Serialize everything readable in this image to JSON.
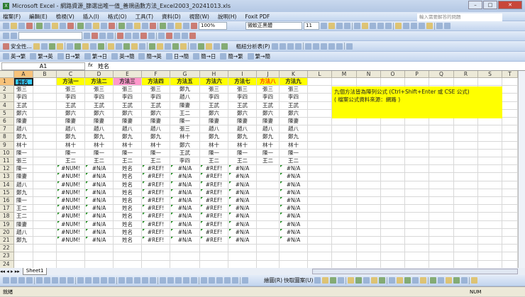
{
  "window": {
    "title": "Microsoft Excel - 網路資源_篩選出唯一值_善規函數方法_Excel2003_20241013.xls"
  },
  "menu": [
    "檔案(F)",
    "編輯(E)",
    "檢視(V)",
    "插入(I)",
    "格式(O)",
    "工具(T)",
    "資料(D)",
    "視窗(W)",
    "說明(H)",
    "Foxit PDF"
  ],
  "help_placeholder": "輸入需要解答的問題",
  "toolbar": {
    "zoom": "100%",
    "font": "微軟正黑體",
    "size": "11",
    "security": "安全性...",
    "pivot": "樞紐分析表(P)",
    "convert": [
      "英→繁",
      "繁→英",
      "日→繁",
      "繁→日",
      "英→簡",
      "簡→英",
      "日→簡",
      "簡→日",
      "簡→繁",
      "繁→簡"
    ],
    "draw": "繪圖(R)",
    "autoshape": "快取圖案(U)"
  },
  "formula_bar": {
    "name_box": "A1",
    "fx": "fx",
    "value": "姓名"
  },
  "columns": [
    "A",
    "B",
    "C",
    "D",
    "E",
    "F",
    "G",
    "H",
    "I",
    "J",
    "K",
    "L",
    "M",
    "N",
    "O",
    "P",
    "Q",
    "R",
    "S",
    "T"
  ],
  "rows": [
    [
      "姓名",
      "",
      "方法一",
      "方法二",
      "方法三",
      "方法四",
      "方法五",
      "方法六",
      "方法七",
      "方法八",
      "方法九"
    ],
    [
      "張三",
      "",
      "張三",
      "張三",
      "張三",
      "張三",
      "鄭九",
      "張三",
      "張三",
      "張三",
      "張三"
    ],
    [
      "李四",
      "",
      "李四",
      "李四",
      "李四",
      "李四",
      "趙八",
      "李四",
      "李四",
      "李四",
      "李四"
    ],
    [
      "王武",
      "",
      "王武",
      "王武",
      "王武",
      "王武",
      "陳妻",
      "王武",
      "王武",
      "王武",
      "王武"
    ],
    [
      "鄭六",
      "",
      "鄭六",
      "鄭六",
      "鄭六",
      "鄭六",
      "王二",
      "鄭六",
      "鄭六",
      "鄭六",
      "鄭六"
    ],
    [
      "陳妻",
      "",
      "陳妻",
      "陳妻",
      "陳妻",
      "陳妻",
      "陳一",
      "陳妻",
      "陳妻",
      "陳妻",
      "陳妻"
    ],
    [
      "趙八",
      "",
      "趙八",
      "趙八",
      "趙八",
      "趙八",
      "張三",
      "趙八",
      "趙八",
      "趙八",
      "趙八"
    ],
    [
      "鄭九",
      "",
      "鄭九",
      "鄭九",
      "鄭九",
      "鄭九",
      "林十",
      "鄭九",
      "鄭九",
      "鄭九",
      "鄭九"
    ],
    [
      "林十",
      "",
      "林十",
      "林十",
      "林十",
      "林十",
      "鄭六",
      "林十",
      "林十",
      "林十",
      "林十"
    ],
    [
      "陳一",
      "",
      "陳一",
      "陳一",
      "陳一",
      "陳一",
      "王武",
      "陳一",
      "陳一",
      "陳一",
      "陳一"
    ],
    [
      "張三",
      "",
      "王二",
      "王二",
      "王二",
      "王二",
      "李四",
      "王二",
      "王二",
      "王二",
      "王二"
    ],
    [
      "陳一",
      "",
      "#NUM!",
      "#N/A",
      "姓名",
      "#REF!",
      "#N/A",
      "#REF!",
      "#N/A",
      "",
      "#N/A"
    ],
    [
      "陳妻",
      "",
      "#NUM!",
      "#N/A",
      "姓名",
      "#REF!",
      "#N/A",
      "#REF!",
      "#N/A",
      "",
      "#N/A"
    ],
    [
      "趙八",
      "",
      "#NUM!",
      "#N/A",
      "姓名",
      "#REF!",
      "#N/A",
      "#REF!",
      "#N/A",
      "",
      "#N/A"
    ],
    [
      "鄭九",
      "",
      "#NUM!",
      "#N/A",
      "姓名",
      "#REF!",
      "#N/A",
      "#REF!",
      "#N/A",
      "",
      "#N/A"
    ],
    [
      "陳一",
      "",
      "#NUM!",
      "#N/A",
      "姓名",
      "#REF!",
      "#N/A",
      "#REF!",
      "#N/A",
      "",
      "#N/A"
    ],
    [
      "王二",
      "",
      "#NUM!",
      "#N/A",
      "姓名",
      "#REF!",
      "#N/A",
      "#REF!",
      "#N/A",
      "",
      "#N/A"
    ],
    [
      "王二",
      "",
      "#NUM!",
      "#N/A",
      "姓名",
      "#REF!",
      "#N/A",
      "#REF!",
      "#N/A",
      "",
      "#N/A"
    ],
    [
      "陳妻",
      "",
      "#NUM!",
      "#N/A",
      "姓名",
      "#REF!",
      "#N/A",
      "#REF!",
      "#N/A",
      "",
      "#N/A"
    ],
    [
      "趙八",
      "",
      "#NUM!",
      "#N/A",
      "姓名",
      "#REF!",
      "#N/A",
      "#REF!",
      "#N/A",
      "",
      "#N/A"
    ],
    [
      "鄭九",
      "",
      "#NUM!",
      "#N/A",
      "姓名",
      "#REF!",
      "#N/A",
      "#REF!",
      "#N/A",
      "",
      "#N/A"
    ]
  ],
  "note": {
    "line1": "九個方法皆為陣列公式 (Ctrl+Shift+Enter 或 CSE 公式)",
    "line2": "( 檔案公式資料來源：網路 )"
  },
  "sheet_tab": "Sheet1",
  "status": {
    "ready": "就緒",
    "num": "NUM"
  },
  "colors": {
    "yellow": "#ffff00",
    "pink": "#ff99cc",
    "cyan": "#33ccff",
    "red_text": "#ff3300"
  }
}
